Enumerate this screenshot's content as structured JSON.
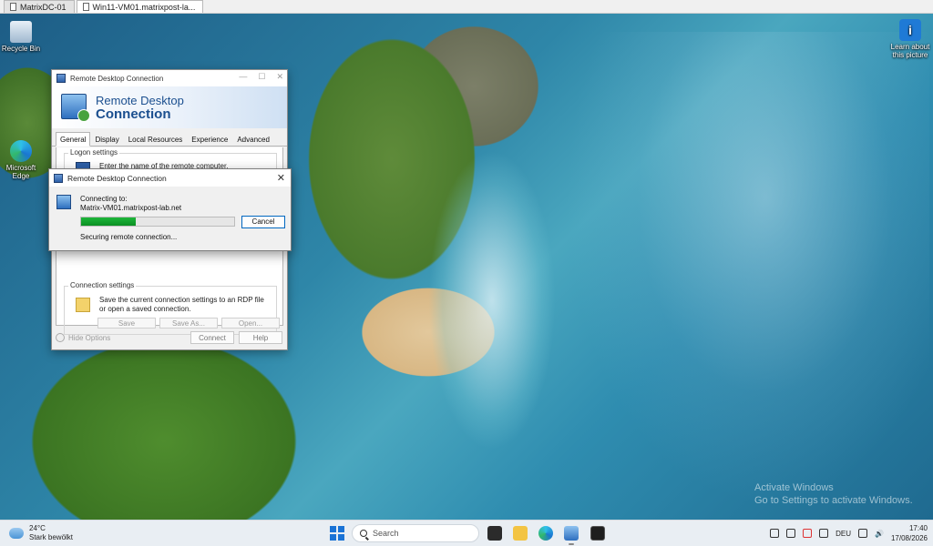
{
  "host_tabs": [
    "MatrixDC-01",
    "Win11-VM01.matrixpost-la..."
  ],
  "desktop_icons": {
    "recycle": "Recycle Bin",
    "edge": "Microsoft Edge",
    "learn": "Learn about this picture"
  },
  "watermark": {
    "line1": "Activate Windows",
    "line2": "Go to Settings to activate Windows."
  },
  "rdc": {
    "title": "Remote Desktop Connection",
    "banner_line1": "Remote Desktop",
    "banner_line2": "Connection",
    "tabs": [
      "General",
      "Display",
      "Local Resources",
      "Experience",
      "Advanced"
    ],
    "logon_group": "Logon settings",
    "logon_text": "Enter the name of the remote computer.",
    "conn_group": "Connection settings",
    "conn_text": "Save the current connection settings to an RDP file or open a saved connection.",
    "save": "Save",
    "save_as": "Save As...",
    "open": "Open...",
    "hide_options": "Hide Options",
    "connect": "Connect",
    "help": "Help"
  },
  "connecting": {
    "title": "Remote Desktop Connection",
    "line1": "Connecting to:",
    "host": "Matrix-VM01.matrixpost-lab.net",
    "status": "Securing remote connection...",
    "cancel": "Cancel",
    "progress": 0.36
  },
  "taskbar": {
    "temp": "24°C",
    "condition": "Stark bewölkt",
    "search_placeholder": "Search",
    "lang": "DEU",
    "time": "17:40",
    "date": "17/08/2026"
  }
}
